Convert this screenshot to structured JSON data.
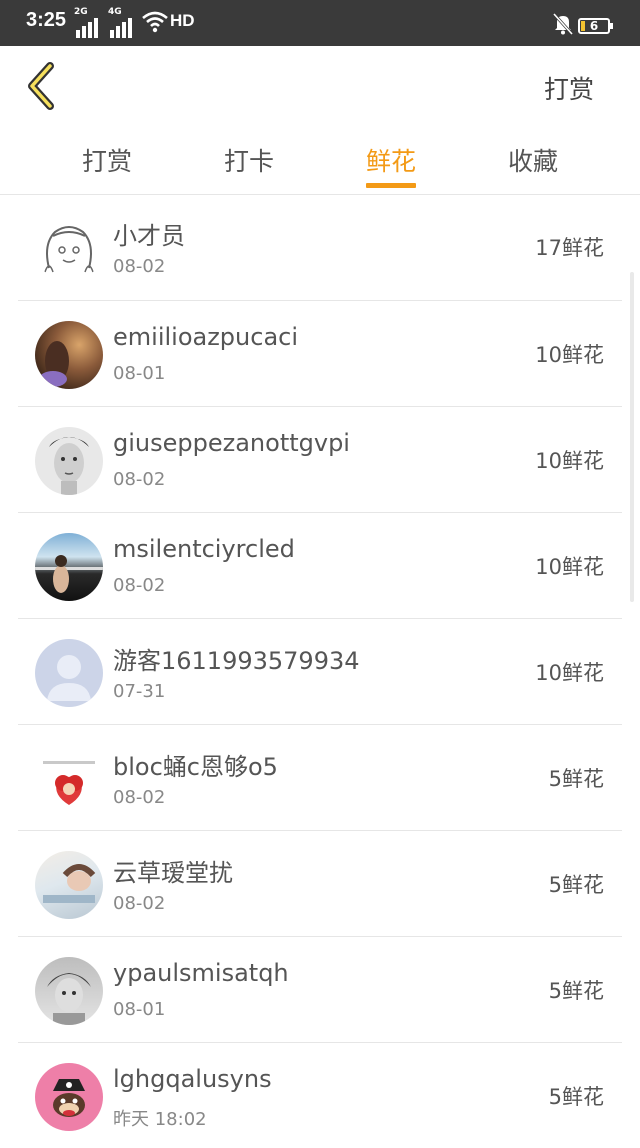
{
  "status_bar": {
    "time": "3:25",
    "network1": "2G",
    "network2": "4G",
    "wifi_label": "HD",
    "battery": "6"
  },
  "header": {
    "back_icon": "chevron-left-icon",
    "action_label": "打赏"
  },
  "tabs": [
    {
      "label": "打赏",
      "active": false
    },
    {
      "label": "打卡",
      "active": false
    },
    {
      "label": "鲜花",
      "active": true
    },
    {
      "label": "收藏",
      "active": false
    }
  ],
  "accent_color": "#f39a16",
  "list": [
    {
      "name": "小才员",
      "date": "08-02",
      "count": "17鲜花"
    },
    {
      "name": "emiilioazpucaci",
      "date": "08-01",
      "count": "10鲜花"
    },
    {
      "name": "giuseppezanottgvpi",
      "date": "08-02",
      "count": "10鲜花"
    },
    {
      "name": "msilentciyrcled",
      "date": "08-02",
      "count": "10鲜花"
    },
    {
      "name": "游客1611993579934",
      "date": "07-31",
      "count": "10鲜花"
    },
    {
      "name": "bloc蛹c恩够o5",
      "date": "08-02",
      "count": "5鲜花"
    },
    {
      "name": "云草瑷堂扰",
      "date": "08-02",
      "count": "5鲜花"
    },
    {
      "name": "ypaulsmisatqh",
      "date": "08-01",
      "count": "5鲜花"
    },
    {
      "name": "lghgqalusyns",
      "date": "昨天 18:02",
      "count": "5鲜花"
    }
  ]
}
